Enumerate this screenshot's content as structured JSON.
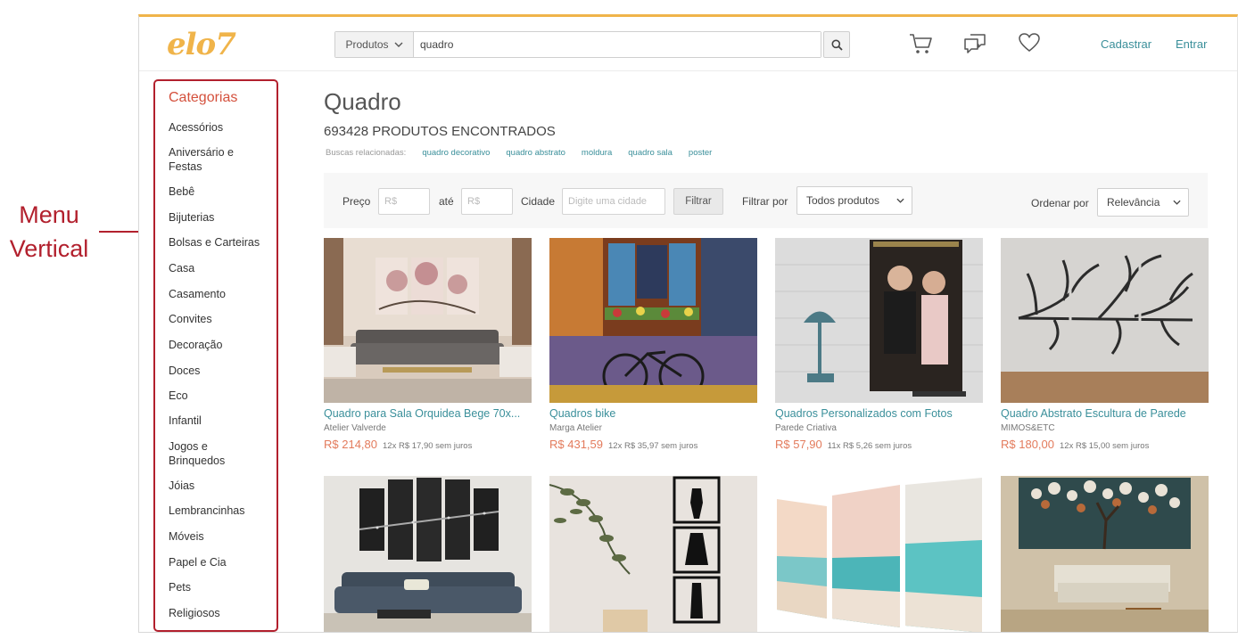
{
  "annotation": {
    "line1": "Menu",
    "line2": "Vertical"
  },
  "header": {
    "logo": "elo7",
    "search": {
      "scope": "Produtos",
      "value": "quadro"
    },
    "icons": [
      "cart-icon",
      "chat-icon",
      "heart-icon",
      "search-icon"
    ],
    "signup": "Cadastrar",
    "login": "Entrar"
  },
  "sidebar": {
    "title": "Categorias",
    "items": [
      "Acessórios",
      "Aniversário e Festas",
      "Bebê",
      "Bijuterias",
      "Bolsas e Carteiras",
      "Casa",
      "Casamento",
      "Convites",
      "Decoração",
      "Doces",
      "Eco",
      "Infantil",
      "Jogos e Brinquedos",
      "Jóias",
      "Lembrancinhas",
      "Móveis",
      "Papel e Cia",
      "Pets",
      "Religiosos"
    ]
  },
  "main": {
    "title": "Quadro",
    "count": "693428 PRODUTOS ENCONTRADOS",
    "related_label": "Buscas relacionadas:",
    "related": [
      "quadro decorativo",
      "quadro abstrato",
      "moldura",
      "quadro sala",
      "poster"
    ]
  },
  "filters": {
    "price_label": "Preço",
    "price_placeholder": "R$",
    "to_label": "até",
    "city_label": "Cidade",
    "city_placeholder": "Digite uma cidade",
    "filter_button": "Filtrar",
    "filter_by_label": "Filtrar por",
    "filter_by_value": "Todos produtos",
    "order_by_label": "Ordenar por",
    "order_by_value": "Relevância"
  },
  "products": [
    {
      "title": "Quadro para Sala Orquidea Bege 70x...",
      "store": "Atelier Valverde",
      "price": "R$ 214,80",
      "installments": "12x R$ 17,90 sem juros"
    },
    {
      "title": "Quadros bike",
      "store": "Marga Atelier",
      "price": "R$ 431,59",
      "installments": "12x R$ 35,97 sem juros"
    },
    {
      "title": "Quadros Personalizados com Fotos",
      "store": "Parede Criativa",
      "price": "R$ 57,90",
      "installments": "11x R$ 5,26 sem juros"
    },
    {
      "title": "Quadro Abstrato Escultura de Parede",
      "store": "MIMOS&ETC",
      "price": "R$ 180,00",
      "installments": "12x R$ 15,00 sem juros"
    }
  ],
  "colors": {
    "accent": "#3a8f9a",
    "price": "#e37b5c",
    "logo": "#f0b44a",
    "annotation": "#b2202d"
  }
}
